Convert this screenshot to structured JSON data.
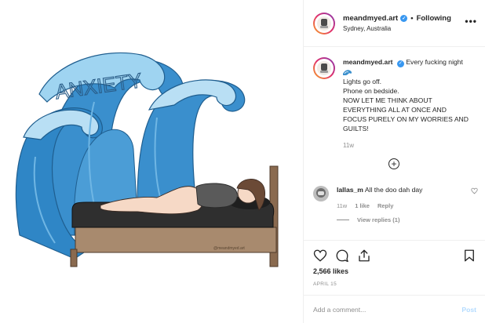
{
  "post": {
    "image_alt": "",
    "watermark": "@meandmyed.art",
    "wave_label": "ANXIETY"
  },
  "header": {
    "username": "meandmyed.art",
    "separator": "•",
    "follow_status": "Following",
    "location": "Sydney, Australia",
    "more_icon": "more-horizontal-icon"
  },
  "caption": {
    "username": "meandmyed.art",
    "first_line": "Every fucking night",
    "emoji": "wave-emoji",
    "lines": [
      "Lights go off.",
      "Phone on bedside.",
      "NOW LET ME THINK ABOUT",
      "EVERYTHING ALL AT ONCE AND",
      "FOCUS PURELY ON MY WORRIES AND",
      "GUILTS!"
    ],
    "time": "11w"
  },
  "load_more_label": "+",
  "comment": {
    "username": "lallas_m",
    "text": "All the doo dah day",
    "time": "11w",
    "likes": "1 like",
    "reply": "Reply",
    "view_replies": "View replies (1)"
  },
  "actions": {
    "likes": "2,566 likes",
    "date": "APRIL 15"
  },
  "add_comment": {
    "placeholder": "Add a comment...",
    "post_label": "Post"
  },
  "colors": {
    "wave_dark": "#2b7fc1",
    "wave_light": "#7ec3ea",
    "foam": "#b9dff4",
    "bed_frame": "#8a6a4f",
    "mattress": "#2f2f2f",
    "verified": "#3897f0",
    "link_disabled": "#b3dbff"
  }
}
